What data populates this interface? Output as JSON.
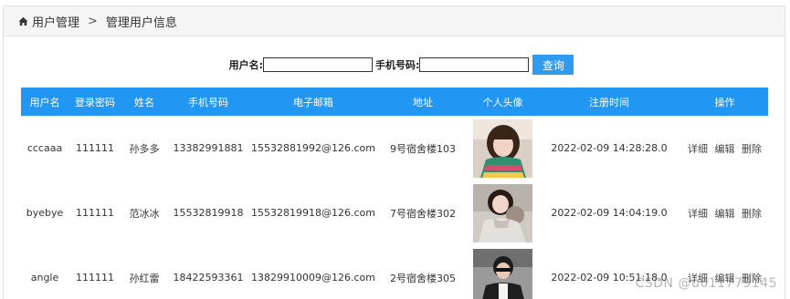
{
  "breadcrumb": {
    "home_icon": "home-icon",
    "section": "用户管理",
    "separator": ">",
    "current": "管理用户信息"
  },
  "search": {
    "username_label": "用户名:",
    "username_value": "",
    "phone_label": "手机号码:",
    "phone_value": "",
    "button_label": "查询"
  },
  "table": {
    "headers": [
      "用户名",
      "登录密码",
      "姓名",
      "手机号码",
      "电子邮箱",
      "地址",
      "个人头像",
      "注册时间",
      "操作"
    ],
    "rows": [
      {
        "username": "cccaaa",
        "password": "111111",
        "name": "孙多多",
        "phone": "13382991881",
        "email": "15532881992@126.com",
        "address": "9号宿舍楼103",
        "registered": "2022-02-09 14:28:28.0",
        "op_detail": "详细",
        "op_edit": "编辑",
        "op_delete": "删除"
      },
      {
        "username": "byebye",
        "password": "111111",
        "name": "范冰冰",
        "phone": "15532819918",
        "email": "15532819918@126.com",
        "address": "7号宿舍楼302",
        "registered": "2022-02-09 14:04:19.0",
        "op_detail": "详细",
        "op_edit": "编辑",
        "op_delete": "删除"
      },
      {
        "username": "angle",
        "password": "111111",
        "name": "孙红雷",
        "phone": "18422593361",
        "email": "13829910009@126.com",
        "address": "2号宿舍楼305",
        "registered": "2022-02-09 10:51:18.0",
        "op_detail": "详细",
        "op_edit": "编辑",
        "op_delete": "删除"
      }
    ]
  },
  "watermark": "CSDN @u011779145",
  "colors": {
    "header_blue": "#2196f3",
    "button_blue": "#2e9bf0",
    "breadcrumb_bg": "#f5f5f5"
  }
}
